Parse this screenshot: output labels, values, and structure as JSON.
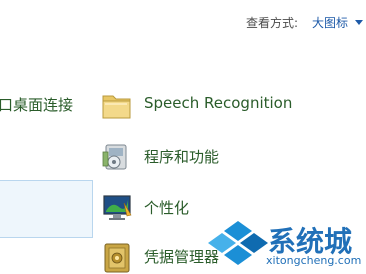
{
  "header": {
    "view_by_label": "查看方式:",
    "view_by_value": "大图标"
  },
  "left_panel": {
    "link_text": "口桌面连接"
  },
  "items": [
    {
      "label": "Speech Recognition",
      "icon": "folder-icon"
    },
    {
      "label": "程序和功能",
      "icon": "programs-features-icon"
    },
    {
      "label": "个性化",
      "icon": "personalization-icon"
    },
    {
      "label": "凭据管理器",
      "icon": "credential-manager-icon"
    }
  ],
  "watermark": {
    "text_cn": "系统城",
    "text_en": "xitongcheng.com"
  },
  "colors": {
    "link_green": "#2a5c2a",
    "link_blue": "#1e5aa8",
    "watermark_blue": "#2170b8"
  }
}
